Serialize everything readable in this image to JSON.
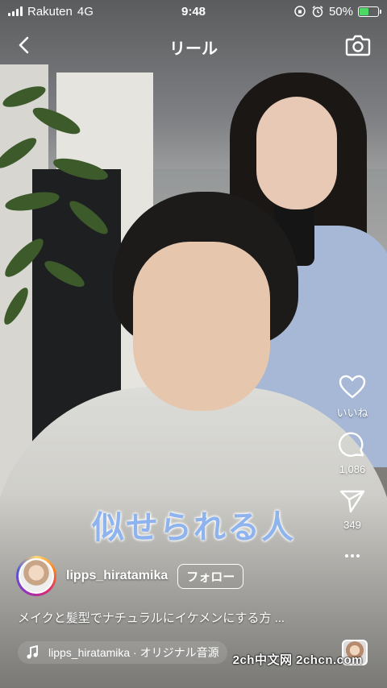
{
  "status_bar": {
    "carrier": "Rakuten",
    "network": "4G",
    "time": "9:48",
    "battery_percent": "50%",
    "battery_level": 0.5,
    "battery_color": "#4cd964"
  },
  "header": {
    "title": "リール",
    "back_icon": "chevron-left-icon",
    "camera_icon": "camera-icon"
  },
  "video": {
    "caption_overlay": "似せられる人"
  },
  "actions": {
    "like_label": "いいね",
    "comment_count": "1,086",
    "share_count": "349"
  },
  "post": {
    "username": "lipps_hiratamika",
    "follow_label": "フォロー",
    "description": "メイクと髪型でナチュラルにイケメンにする方 ...",
    "audio_label": "lipps_hiratamika · オリジナル音源"
  },
  "watermark": "2ch中文网  2chcn.com"
}
